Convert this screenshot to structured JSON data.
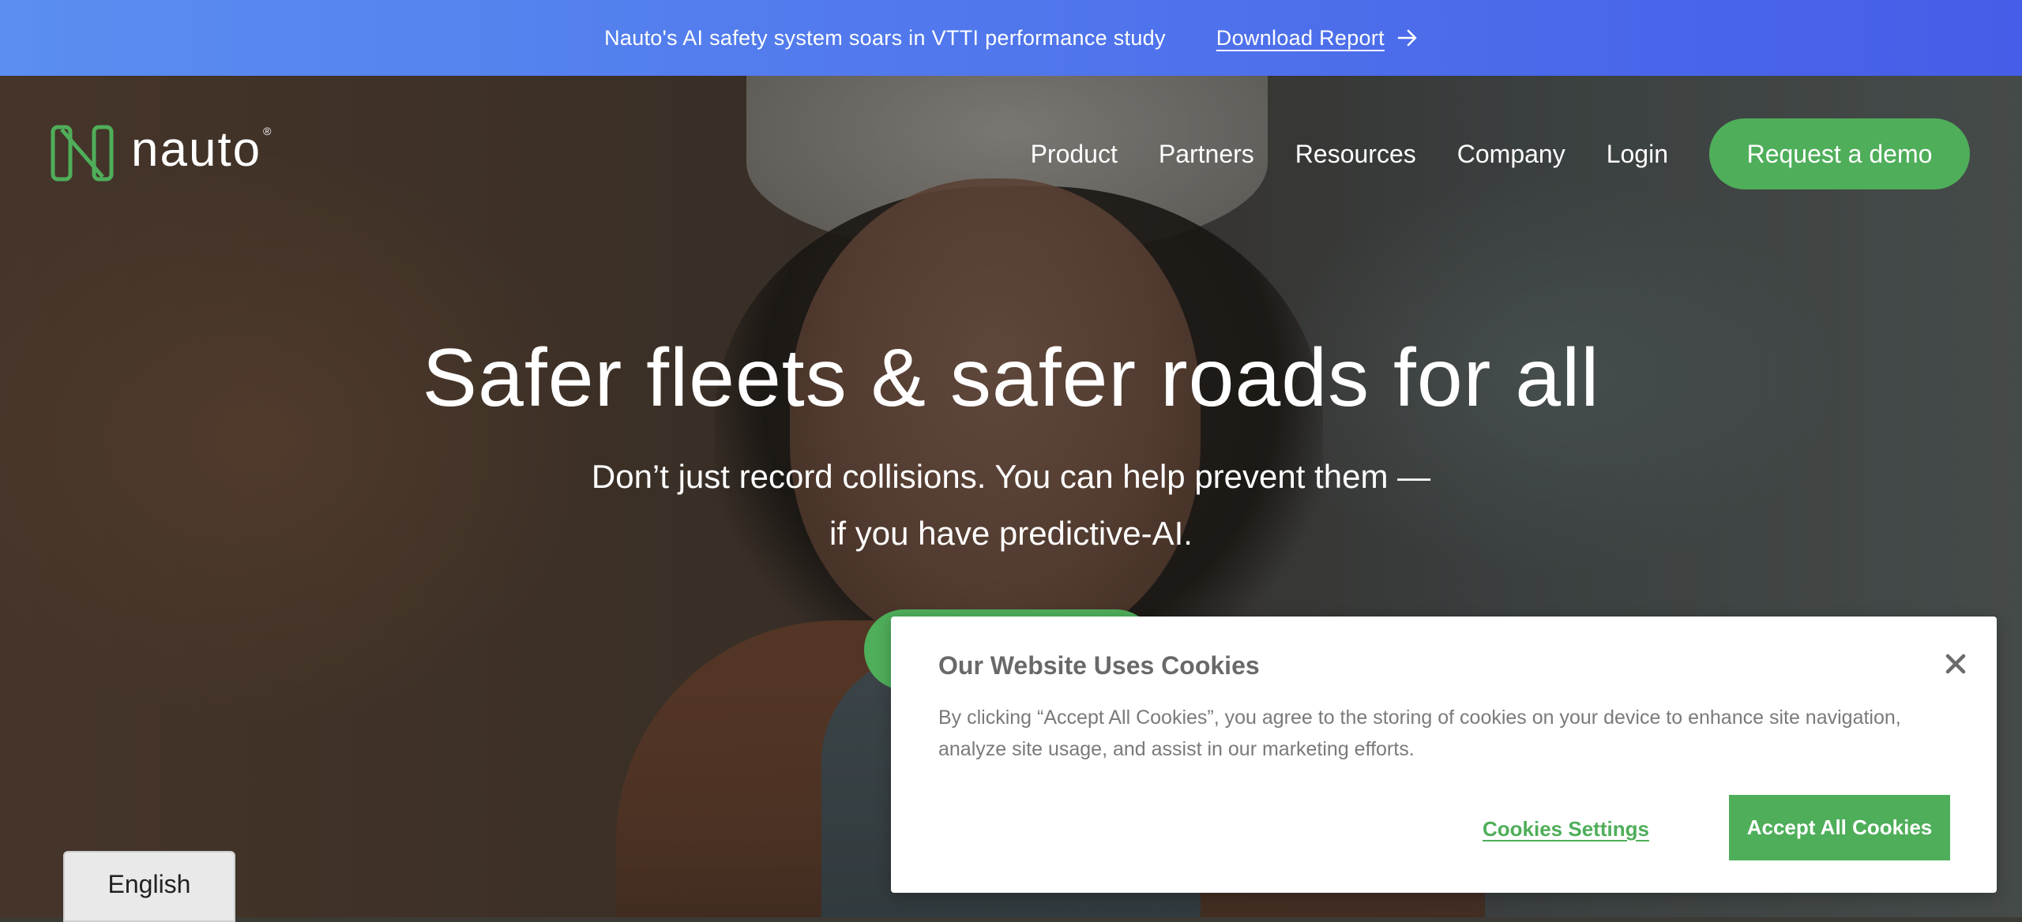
{
  "announcement": {
    "message": "Nauto's AI safety system soars in VTTI performance study",
    "link_label": "Download Report",
    "link_icon": "arrow-right-icon"
  },
  "nav": {
    "logo_text": "nauto",
    "logo_reg": "®",
    "logo_icon": "nauto-n-logo-icon",
    "items": [
      {
        "label": "Product"
      },
      {
        "label": "Partners"
      },
      {
        "label": "Resources"
      },
      {
        "label": "Company"
      },
      {
        "label": "Login"
      }
    ],
    "demo_button": "Request a demo"
  },
  "hero": {
    "title": "Safer fleets & safer roads for all",
    "subtitle_line1": "Don’t just record collisions. You can help prevent them —",
    "subtitle_line2": "if you have predictive-AI."
  },
  "cookie_banner": {
    "title": "Our Website Uses Cookies",
    "body": "By clicking “Accept All Cookies”, you agree to the storing of cookies on your device to enhance site navigation, analyze site usage, and assist in our marketing efforts.",
    "settings_label": "Cookies Settings",
    "accept_label": "Accept All Cookies",
    "close_icon": "close-icon"
  },
  "language": {
    "selected": "English"
  },
  "colors": {
    "brand_green": "#4fae5a",
    "announce_gradient_start": "#5b8ef0",
    "announce_gradient_end": "#455de8",
    "cookie_text": "#7a7a7a"
  }
}
